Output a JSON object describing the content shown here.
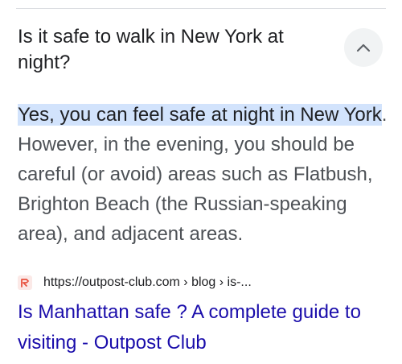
{
  "question": {
    "text": "Is it safe to walk in New York at night?"
  },
  "collapse": {
    "icon": "chevron-up-icon"
  },
  "answer": {
    "highlight": "Yes, you can feel safe at night in New York",
    "rest": ". However, in the evening, you should be careful (or avoid) areas such as Flatbush, Brighton Beach (the Russian-speaking area), and adjacent areas."
  },
  "source": {
    "favicon": "outpost-club-favicon",
    "url": "https://outpost-club.com › blog › is-..."
  },
  "result": {
    "title": "Is Manhattan safe ? A complete guide to visiting - Outpost Club"
  },
  "colors": {
    "highlight": "#d2e3fc",
    "link": "#1a0dab",
    "favicon": "#e8523f"
  }
}
